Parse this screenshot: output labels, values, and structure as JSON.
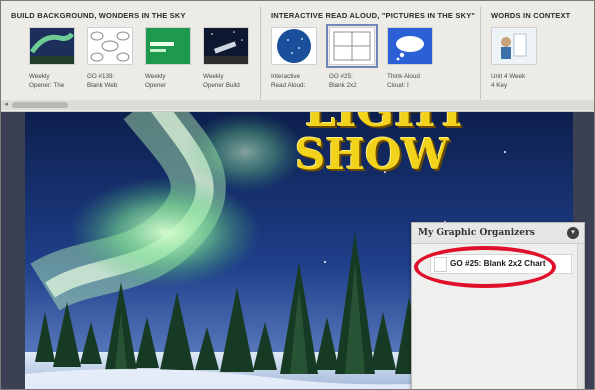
{
  "strip": {
    "sections": [
      {
        "title": "BUILD BACKGROUND, WONDERS IN THE SKY",
        "items": [
          {
            "caption_line1": "Weekly",
            "caption_line2": "Opener: The",
            "thumb": "aurora-thumb"
          },
          {
            "caption_line1": "GO #139:",
            "caption_line2": "Blank Web",
            "thumb": "web-thumb"
          },
          {
            "caption_line1": "Weekly",
            "caption_line2": "Opener",
            "thumb": "green-slide-thumb"
          },
          {
            "caption_line1": "Weekly",
            "caption_line2": "Opener Build",
            "thumb": "telescope-thumb"
          }
        ]
      },
      {
        "title": "INTERACTIVE READ ALOUD, \"PICTURES IN THE SKY\"",
        "items": [
          {
            "caption_line1": "Interactive",
            "caption_line2": "Read Aloud:",
            "thumb": "starmap-thumb"
          },
          {
            "caption_line1": "GO #25:",
            "caption_line2": "Blank 2x2",
            "thumb": "grid-thumb",
            "selected": true
          },
          {
            "caption_line1": "Think Aloud",
            "caption_line2": "Cloud: I",
            "thumb": "cloud-thumb"
          }
        ]
      },
      {
        "title": "WORDS IN CONTEXT",
        "items": [
          {
            "caption_line1": "Unit 4 Week",
            "caption_line2": "4 Key",
            "thumb": "lab-thumb"
          }
        ]
      }
    ],
    "scroll_left_icon": "◂"
  },
  "book": {
    "title_line1": "LIGHT",
    "title_line2": "SHOW"
  },
  "panel": {
    "title": "My Graphic Organizers",
    "collapse_icon": "chevron-down",
    "items": [
      {
        "label": "GO #25: Blank 2x2 Chart"
      }
    ]
  },
  "colors": {
    "highlight": "#e0102a",
    "title_gold": "#f2d21b",
    "sky_blue": "#20304e"
  }
}
